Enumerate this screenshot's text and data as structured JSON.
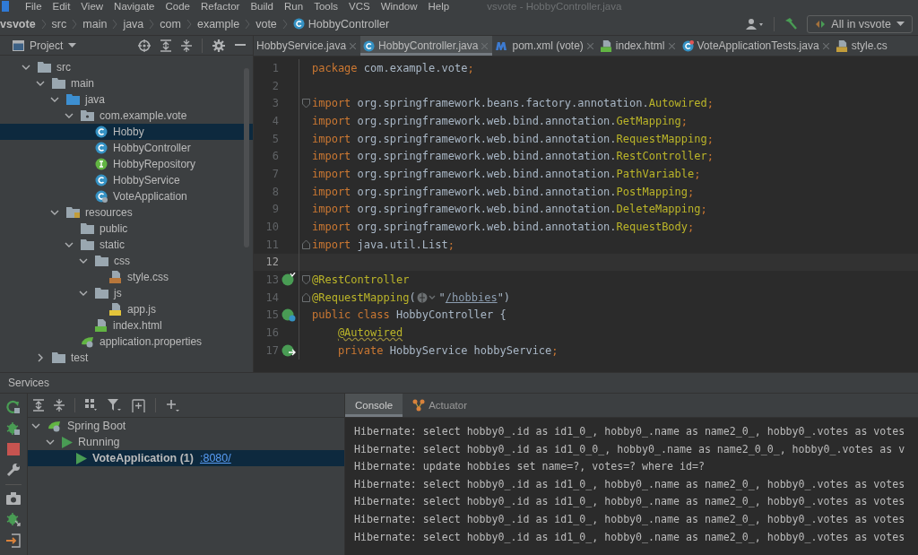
{
  "menu": [
    "File",
    "Edit",
    "View",
    "Navigate",
    "Code",
    "Refactor",
    "Build",
    "Run",
    "Tools",
    "VCS",
    "Window",
    "Help"
  ],
  "window": {
    "title": "vsvote - HobbyController.java"
  },
  "breadcrumbs": [
    {
      "label": "vsvote",
      "kind": "project"
    },
    {
      "label": "src",
      "kind": "dir"
    },
    {
      "label": "main",
      "kind": "dir"
    },
    {
      "label": "java",
      "kind": "dir"
    },
    {
      "label": "com",
      "kind": "dir"
    },
    {
      "label": "example",
      "kind": "dir"
    },
    {
      "label": "vote",
      "kind": "dir"
    },
    {
      "label": "HobbyController",
      "kind": "class"
    }
  ],
  "run_config": {
    "label": "All in vsvote"
  },
  "project_panel": {
    "title": "Project",
    "tree": [
      {
        "label": "src",
        "kind": "folder",
        "expanded": true,
        "selected": false,
        "children": [
          {
            "label": "main",
            "kind": "folder",
            "expanded": true,
            "selected": false,
            "children": [
              {
                "label": "java",
                "kind": "source-folder",
                "expanded": true,
                "selected": false,
                "children": [
                  {
                    "label": "com.example.vote",
                    "kind": "package",
                    "expanded": true,
                    "selected": false,
                    "children": [
                      {
                        "label": "Hobby",
                        "kind": "class",
                        "selected": true
                      },
                      {
                        "label": "HobbyController",
                        "kind": "class",
                        "selected": false
                      },
                      {
                        "label": "HobbyRepository",
                        "kind": "interface",
                        "selected": false
                      },
                      {
                        "label": "HobbyService",
                        "kind": "class",
                        "selected": false
                      },
                      {
                        "label": "VoteApplication",
                        "kind": "spring-class",
                        "selected": false
                      }
                    ]
                  }
                ]
              },
              {
                "label": "resources",
                "kind": "resources-folder",
                "expanded": true,
                "selected": false,
                "children": [
                  {
                    "label": "public",
                    "kind": "folder",
                    "selected": false
                  },
                  {
                    "label": "static",
                    "kind": "folder",
                    "expanded": true,
                    "selected": false,
                    "children": [
                      {
                        "label": "css",
                        "kind": "folder",
                        "expanded": true,
                        "selected": false,
                        "children": [
                          {
                            "label": "style.css",
                            "kind": "css-file",
                            "selected": false
                          }
                        ]
                      },
                      {
                        "label": "js",
                        "kind": "folder",
                        "expanded": true,
                        "selected": false,
                        "children": [
                          {
                            "label": "app.js",
                            "kind": "js-file",
                            "selected": false
                          }
                        ]
                      },
                      {
                        "label": "index.html",
                        "kind": "html-file",
                        "selected": false
                      }
                    ]
                  },
                  {
                    "label": "application.properties",
                    "kind": "spring-properties",
                    "selected": false
                  }
                ]
              }
            ]
          },
          {
            "label": "test",
            "kind": "folder",
            "expanded": false,
            "selected": false
          }
        ]
      }
    ]
  },
  "editor_tabs": [
    {
      "label": "HobbyService.java",
      "kind": "plain",
      "selected": false
    },
    {
      "label": "HobbyController.java",
      "kind": "class",
      "selected": true
    },
    {
      "label": "pom.xml (vote)",
      "kind": "maven",
      "selected": false
    },
    {
      "label": "index.html",
      "kind": "html-file",
      "selected": false
    },
    {
      "label": "VoteApplicationTests.java",
      "kind": "test-class",
      "selected": false
    },
    {
      "label": "style.cs",
      "kind": "css-file",
      "selected": false
    }
  ],
  "editor": {
    "lines": [
      {
        "number": "1",
        "current": false,
        "kind": "plain",
        "segments": [
          {
            "kind": "kw",
            "text": "package "
          },
          {
            "kind": "p",
            "text": "com.example.vote"
          },
          {
            "kind": "kw",
            "text": ";"
          }
        ]
      },
      {
        "number": "2",
        "current": false,
        "kind": "plain"
      },
      {
        "number": "3",
        "current": false,
        "kind": "fold-start",
        "segments": [
          {
            "kind": "kw",
            "text": "import "
          },
          {
            "kind": "p",
            "text": "org.springframework.beans.factory.annotation."
          },
          {
            "kind": "a",
            "text": "Autowired"
          },
          {
            "kind": "kw",
            "text": ";"
          }
        ]
      },
      {
        "number": "4",
        "current": false,
        "kind": "plain",
        "segments": [
          {
            "kind": "kw",
            "text": "import "
          },
          {
            "kind": "p",
            "text": "org.springframework.web.bind.annotation."
          },
          {
            "kind": "a",
            "text": "GetMapping"
          },
          {
            "kind": "kw",
            "text": ";"
          }
        ]
      },
      {
        "number": "5",
        "current": false,
        "kind": "plain",
        "segments": [
          {
            "kind": "kw",
            "text": "import "
          },
          {
            "kind": "p",
            "text": "org.springframework.web.bind.annotation."
          },
          {
            "kind": "a",
            "text": "RequestMapping"
          },
          {
            "kind": "kw",
            "text": ";"
          }
        ]
      },
      {
        "number": "6",
        "current": false,
        "kind": "plain",
        "segments": [
          {
            "kind": "kw",
            "text": "import "
          },
          {
            "kind": "p",
            "text": "org.springframework.web.bind.annotation."
          },
          {
            "kind": "a",
            "text": "RestController"
          },
          {
            "kind": "kw",
            "text": ";"
          }
        ]
      },
      {
        "number": "7",
        "current": false,
        "kind": "plain",
        "segments": [
          {
            "kind": "kw",
            "text": "import "
          },
          {
            "kind": "p",
            "text": "org.springframework.web.bind.annotation."
          },
          {
            "kind": "a",
            "text": "PathVariable"
          },
          {
            "kind": "kw",
            "text": ";"
          }
        ]
      },
      {
        "number": "8",
        "current": false,
        "kind": "plain",
        "segments": [
          {
            "kind": "kw",
            "text": "import "
          },
          {
            "kind": "p",
            "text": "org.springframework.web.bind.annotation."
          },
          {
            "kind": "a",
            "text": "PostMapping"
          },
          {
            "kind": "kw",
            "text": ";"
          }
        ]
      },
      {
        "number": "9",
        "current": false,
        "kind": "plain",
        "segments": [
          {
            "kind": "kw",
            "text": "import "
          },
          {
            "kind": "p",
            "text": "org.springframework.web.bind.annotation."
          },
          {
            "kind": "a",
            "text": "DeleteMapping"
          },
          {
            "kind": "kw",
            "text": ";"
          }
        ]
      },
      {
        "number": "10",
        "current": false,
        "kind": "plain",
        "segments": [
          {
            "kind": "kw",
            "text": "import "
          },
          {
            "kind": "p",
            "text": "org.springframework.web.bind.annotation."
          },
          {
            "kind": "a",
            "text": "RequestBody"
          },
          {
            "kind": "kw",
            "text": ";"
          }
        ]
      },
      {
        "number": "11",
        "current": false,
        "kind": "fold-end",
        "segments": [
          {
            "kind": "kw",
            "text": "import "
          },
          {
            "kind": "p",
            "text": "java.util.List"
          },
          {
            "kind": "kw",
            "text": ";"
          }
        ]
      },
      {
        "number": "12",
        "current": true,
        "kind": "plain"
      },
      {
        "number": "13",
        "current": false,
        "kind": "fold-start",
        "gutter": {
          "kind": "bean-check"
        },
        "segments": [
          {
            "kind": "a",
            "text": "@RestController"
          }
        ]
      },
      {
        "number": "14",
        "current": false,
        "kind": "fold-end",
        "segments": [
          {
            "kind": "a",
            "text": "@RequestMapping"
          },
          {
            "kind": "p",
            "text": "("
          },
          {
            "kind": "inlay"
          },
          {
            "kind": "p",
            "text": "\""
          },
          {
            "kind": "link",
            "text": "/hobbies"
          },
          {
            "kind": "p",
            "text": "\")"
          }
        ]
      },
      {
        "number": "15",
        "current": false,
        "kind": "plain",
        "gutter": {
          "kind": "bean-web"
        },
        "segments": [
          {
            "kind": "kw",
            "text": "public class "
          },
          {
            "kind": "p",
            "text": "HobbyController {"
          }
        ]
      },
      {
        "number": "16",
        "current": false,
        "kind": "plain",
        "segments": [
          {
            "kind": "indent"
          },
          {
            "kind": "warn",
            "text": "@Autowired"
          }
        ]
      },
      {
        "number": "17",
        "current": false,
        "kind": "plain",
        "gutter": {
          "kind": "bean-inject"
        },
        "segments": [
          {
            "kind": "indent"
          },
          {
            "kind": "kw",
            "text": "private "
          },
          {
            "kind": "p",
            "text": "HobbyService "
          },
          {
            "kind": "f",
            "text": "hobbyService"
          },
          {
            "kind": "kw",
            "text": ";"
          }
        ]
      }
    ]
  },
  "services": {
    "title": "Services",
    "tree": [
      {
        "label": "Spring Boot",
        "kind": "spring-group",
        "expanded": true,
        "selected": false,
        "children": [
          {
            "label": "Running",
            "kind": "run-group",
            "expanded": true,
            "selected": false,
            "children": [
              {
                "label": "VoteApplication (1)",
                "kind": "app",
                "link": ":8080/",
                "selected": true
              }
            ]
          }
        ]
      }
    ],
    "tabs": [
      {
        "label": "Console",
        "kind": "plain",
        "selected": true
      },
      {
        "label": "Actuator",
        "kind": "actuator",
        "selected": false
      }
    ],
    "console": [
      "Hibernate: select hobby0_.id as id1_0_, hobby0_.name as name2_0_, hobby0_.votes as votes",
      "Hibernate: select hobby0_.id as id1_0_0_, hobby0_.name as name2_0_0_, hobby0_.votes as v",
      "Hibernate: update hobbies set name=?, votes=? where id=?",
      "Hibernate: select hobby0_.id as id1_0_, hobby0_.name as name2_0_, hobby0_.votes as votes",
      "Hibernate: select hobby0_.id as id1_0_, hobby0_.name as name2_0_, hobby0_.votes as votes",
      "Hibernate: select hobby0_.id as id1_0_, hobby0_.name as name2_0_, hobby0_.votes as votes",
      "Hibernate: select hobby0_.id as id1_0_, hobby0_.name as name2_0_, hobby0_.votes as votes"
    ]
  }
}
